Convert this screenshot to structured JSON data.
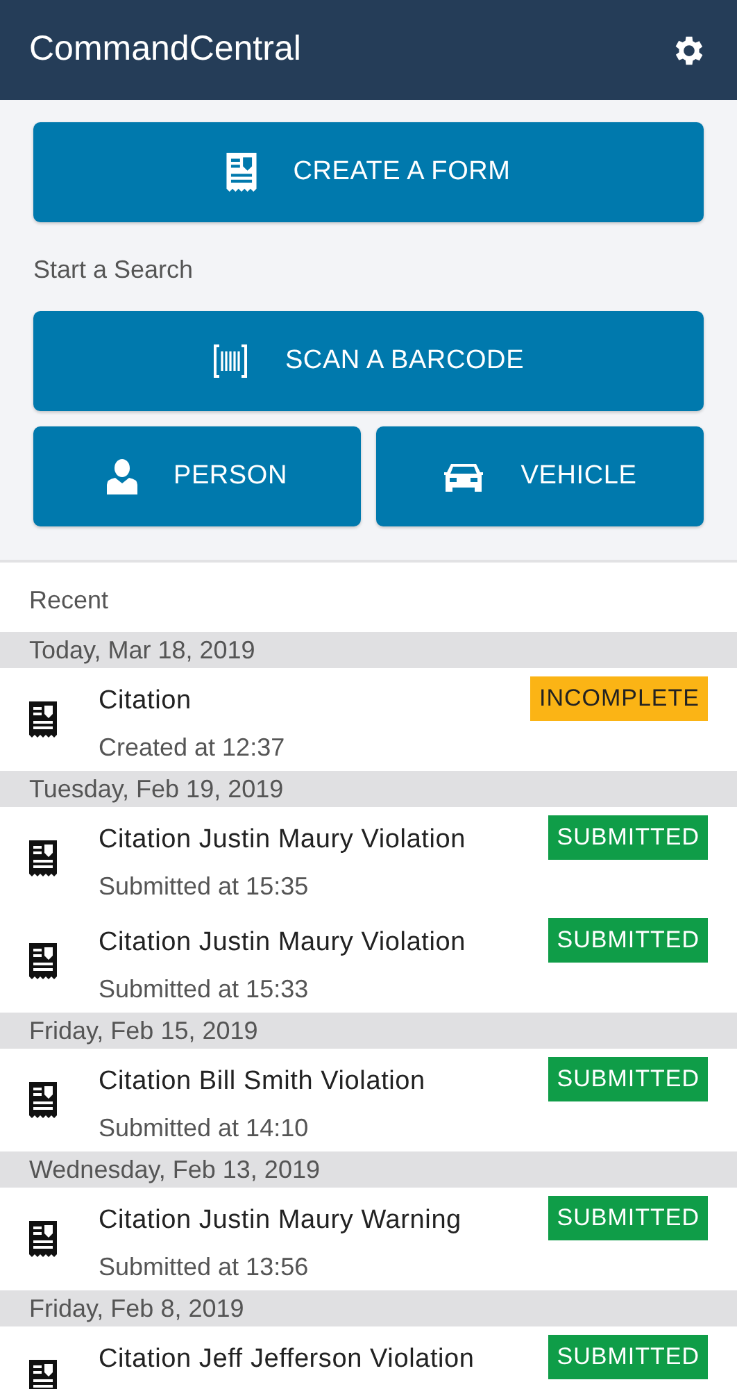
{
  "app_bar": {
    "title": "CommandCentral"
  },
  "create_button": {
    "label": "CREATE A FORM"
  },
  "search_section": {
    "title": "Start a Search",
    "buttons": [
      {
        "kind": "barcode",
        "label": "SCAN A BARCODE"
      },
      {
        "kind": "person",
        "label": "PERSON"
      },
      {
        "kind": "vehicle",
        "label": "VEHICLE"
      }
    ]
  },
  "recent": {
    "title": "Recent",
    "groups": [
      {
        "date": "Today, Mar 18, 2019",
        "items": [
          {
            "title": "Citation",
            "subtitle": "Created at 12:37",
            "status": "INCOMPLETE",
            "color": "#fbb415"
          }
        ]
      },
      {
        "date": "Tuesday, Feb 19, 2019",
        "items": [
          {
            "title": "Citation Justin Maury Violation",
            "subtitle": "Submitted at 15:35",
            "status": "SUBMITTED",
            "color": "#0f9d48"
          },
          {
            "title": "Citation Justin Maury Violation",
            "subtitle": "Submitted at 15:33",
            "status": "SUBMITTED",
            "color": "#0f9d48"
          }
        ]
      },
      {
        "date": "Friday, Feb 15, 2019",
        "items": [
          {
            "title": "Citation Bill Smith Violation",
            "subtitle": "Submitted at 14:10",
            "status": "SUBMITTED",
            "color": "#0f9d48"
          }
        ]
      },
      {
        "date": "Wednesday, Feb 13, 2019",
        "items": [
          {
            "title": "Citation Justin Maury Warning",
            "subtitle": "Submitted at 13:56",
            "status": "SUBMITTED",
            "color": "#0f9d48"
          }
        ]
      },
      {
        "date": "Friday, Feb 8, 2019",
        "items": [
          {
            "title": "Citation Jeff Jefferson Violation",
            "status": "SUBMITTED",
            "color": "#0f9d48"
          }
        ]
      }
    ]
  }
}
